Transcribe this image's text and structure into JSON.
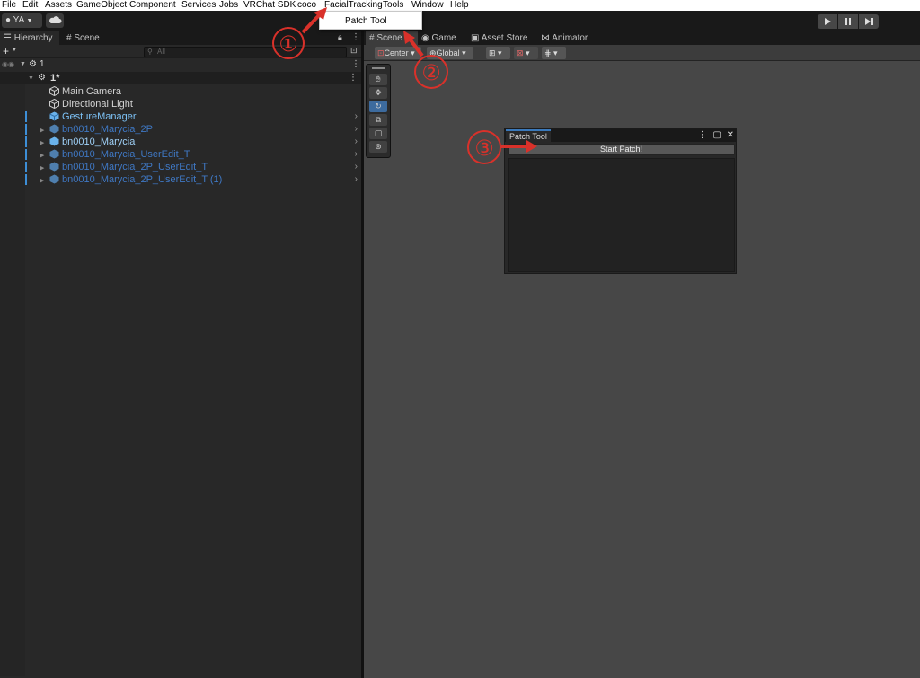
{
  "menu": [
    "File",
    "Edit",
    "Assets",
    "GameObject",
    "Component",
    "Services",
    "Jobs",
    "VRChat SDK",
    "coco",
    "FacialTracking",
    "Tools",
    "Window",
    "Help"
  ],
  "toolbar": {
    "account": "YA"
  },
  "dropdown": {
    "item": "Patch Tool"
  },
  "hierarchy": {
    "tabs": [
      "Hierarchy",
      "Scene"
    ],
    "add_label": "+",
    "search_placeholder": "All",
    "scene_root": "1",
    "scene_child": "1*",
    "items": [
      "Main Camera",
      "Directional Light",
      "GestureManager",
      "bn0010_Marycia_2P",
      "bn0010_Marycia",
      "bn0010_Marycia_UserEdit_T",
      "bn0010_Marycia_2P_UserEdit_T",
      "bn0010_Marycia_2P_UserEdit_T (1)"
    ]
  },
  "scene": {
    "tabs": [
      "Scene",
      "Game",
      "Asset Store",
      "Animator"
    ],
    "pivot": "Center",
    "space": "Global"
  },
  "patch_window": {
    "title": "Patch Tool",
    "button": "Start Patch!"
  },
  "annotations": [
    "①",
    "②",
    "③"
  ],
  "colors": {
    "annotation": "#d9312a",
    "prefab_blue": "#3f78c4",
    "active_tab": "#3a79bb"
  }
}
